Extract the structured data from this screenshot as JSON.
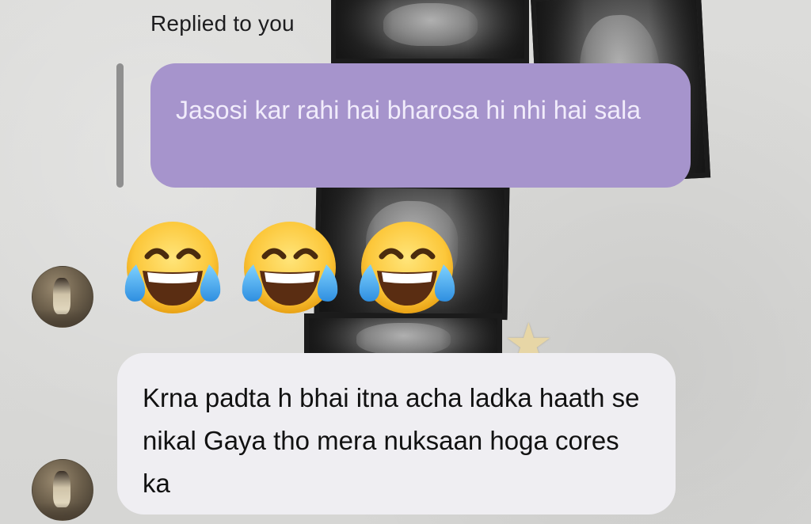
{
  "reply": {
    "label": "Replied to you",
    "quoted_text": "Jasosi kar rahi hai bharosa hi nhi hai sala"
  },
  "emoji_message": {
    "emojis": [
      "face-with-tears-of-joy",
      "face-with-tears-of-joy",
      "face-with-tears-of-joy"
    ]
  },
  "message": {
    "text": "Krna padta h bhai itna acha ladka haath se nikal Gaya tho mera nuksaan hoga cores ka"
  },
  "colors": {
    "reply_bubble": "#a694cc",
    "reply_text": "#f1ecfb",
    "incoming_bubble": "#efeef2",
    "background": "#d9d9d7"
  }
}
